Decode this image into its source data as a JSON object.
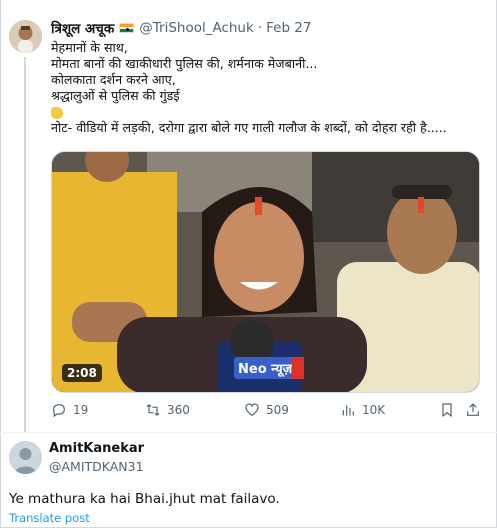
{
  "tweet": {
    "author_name": "त्रिशूल अचूक",
    "author_handle": "@TriShool_Achuk",
    "separator": "·",
    "date": "Feb 27",
    "lines": [
      "मेहमानों के साथ,",
      "मोमता बानों की खाकीधारी पुलिस की, शर्मनाक मेजबानी...",
      "कोलकाता दर्शन करने आए,",
      "श्रद्धालुओं से पुलिस की गुंडई",
      "नोट- वीडियो में लड़की, दरोगा द्वारा बोले गए गाली गलौज के शब्दों, को दोहरा रही है....."
    ],
    "emoji_icon": "waving-hand-icon",
    "video": {
      "duration": "2:08",
      "mic_logo_text": "Neo न्यूज़"
    },
    "actions": {
      "replies": "19",
      "retweets": "360",
      "likes": "509",
      "views": "10K"
    }
  },
  "reply": {
    "author_name": "AmitKanekar",
    "author_handle": "@AMITDKAN31",
    "text": "Ye mathura ka hai Bhai.jhut mat failavo.",
    "translate_label": "Translate post"
  },
  "colors": {
    "text": "#0f1419",
    "muted": "#536471",
    "link": "#1d9bf0",
    "border": "#cfd9de"
  }
}
